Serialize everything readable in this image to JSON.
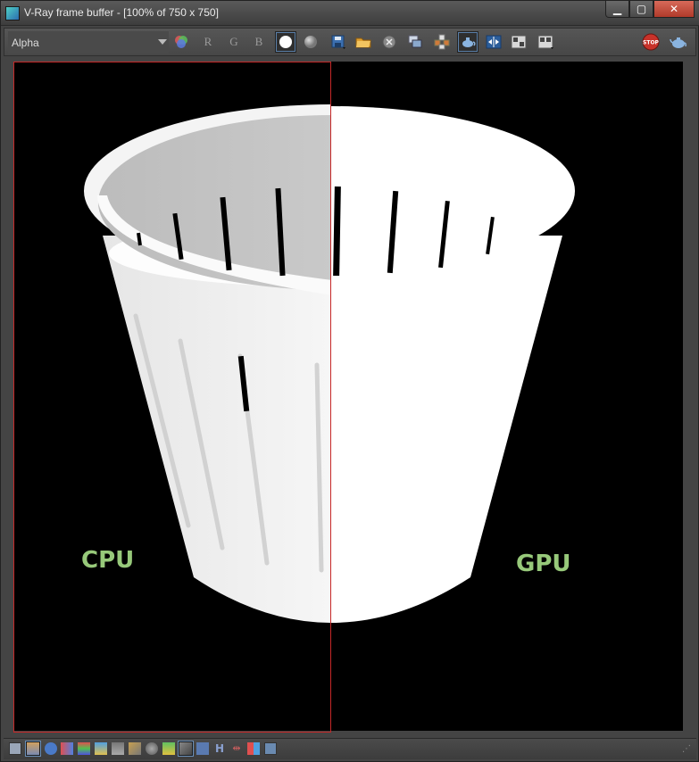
{
  "window": {
    "title": "V-Ray frame buffer - [100% of 750 x 750]",
    "buttons": {
      "minimize": "▁",
      "maximize": "▢",
      "close": "✕"
    }
  },
  "toolbar": {
    "channel": "Alpha",
    "channel_letters": {
      "r": "R",
      "g": "G",
      "b": "B"
    },
    "icons": [
      "color-channels-icon",
      "white-circle-icon",
      "grey-circle-icon",
      "save-icon",
      "open-folder-icon",
      "clear-icon",
      "duplicate-icon",
      "track-mouse-icon",
      "render-region-icon",
      "compare-icon",
      "ab-horizontal-icon",
      "ab-vertical-icon",
      "stop-icon",
      "render-teapot-icon"
    ],
    "stop_label": "STOP"
  },
  "canvas": {
    "labels": {
      "cpu": "CPU",
      "gpu": "GPU"
    },
    "region_color": "#c62828",
    "label_color": "#97c97a"
  },
  "statusbar": {
    "icons": [
      "display-icon",
      "history-icon",
      "info-icon",
      "color-correction-icon",
      "levels-icon",
      "curves-icon",
      "histogram-icon",
      "exposure-icon",
      "lut-icon",
      "settings-icon",
      "lens-effects-icon",
      "stamp-icon",
      "h-icon",
      "compare-split-icon",
      "flag-icon",
      "pixel-aspect-icon"
    ],
    "h_label": "H"
  }
}
